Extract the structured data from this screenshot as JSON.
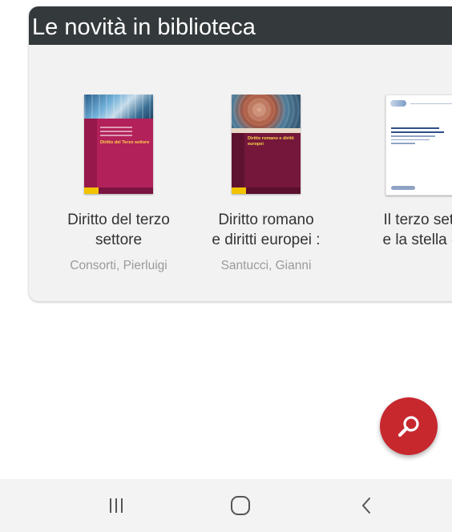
{
  "section": {
    "title": "Le novità in biblioteca"
  },
  "books": [
    {
      "title_line1": "Diritto del terzo",
      "title_line2": "settore",
      "author": "Consorti, Pierluigi",
      "cover_text": "Diritto del Terzo settore"
    },
    {
      "title_line1": "Diritto romano",
      "title_line2": "e diritti europei :",
      "author": "Santucci, Gianni",
      "cover_text": "Diritto romano e diritti europei"
    },
    {
      "title_line1": "Il terzo sett",
      "title_line2": "e la stella c",
      "author": "",
      "cover_text": ""
    }
  ],
  "fab": {
    "icon": "search-icon",
    "color": "#c6282e"
  },
  "navbar": {
    "recents_icon": "recents-icon",
    "home_icon": "home-icon",
    "back_icon": "back-icon"
  },
  "colors": {
    "header_bg": "#343a3c",
    "card_bg": "#f2f2f2",
    "author_text": "#9a9a9a",
    "title_text": "#333333"
  }
}
